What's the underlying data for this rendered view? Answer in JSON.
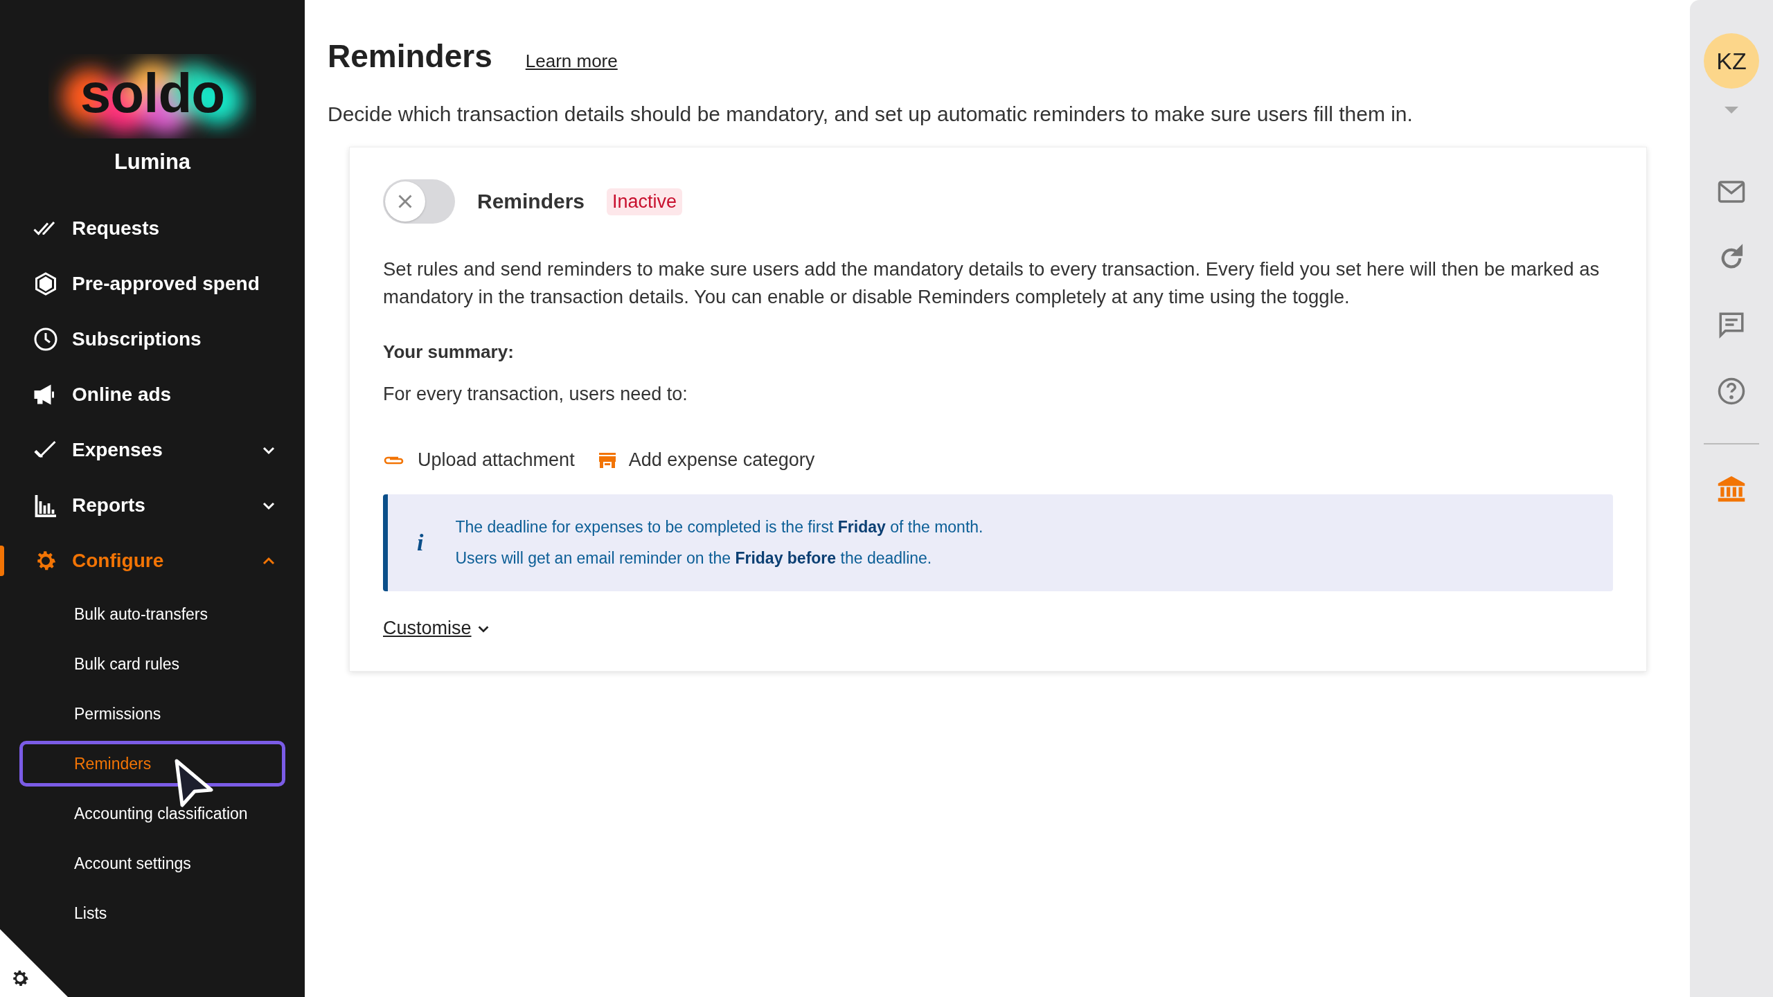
{
  "sidebar": {
    "logo": "soldo",
    "company": "Lumina",
    "items": [
      {
        "label": "Requests",
        "selected": false
      },
      {
        "label": "Pre-approved spend",
        "selected": false
      },
      {
        "label": "Subscriptions",
        "selected": false
      },
      {
        "label": "Online ads",
        "selected": false
      },
      {
        "label": "Expenses",
        "selected": false,
        "expanded": false
      },
      {
        "label": "Reports",
        "selected": false,
        "expanded": false
      },
      {
        "label": "Configure",
        "selected": true,
        "expanded": true,
        "children": [
          {
            "label": "Bulk auto-transfers",
            "selected": false
          },
          {
            "label": "Bulk card rules",
            "selected": false
          },
          {
            "label": "Permissions",
            "selected": false
          },
          {
            "label": "Reminders",
            "selected": true
          },
          {
            "label": "Accounting classification",
            "selected": false
          },
          {
            "label": "Account settings",
            "selected": false
          },
          {
            "label": "Lists",
            "selected": false
          }
        ]
      }
    ]
  },
  "page": {
    "title": "Reminders",
    "learn_more": "Learn more",
    "description": "Decide which transaction details should be mandatory, and set up automatic reminders to make sure users fill them in."
  },
  "card": {
    "toggle": {
      "on": false
    },
    "title": "Reminders",
    "status": "Inactive",
    "body": "Set rules and send reminders to make sure users add the mandatory details to every transaction. Every field you set here will then be marked as mandatory in the transaction details. You can enable or disable Reminders completely at any time using the toggle.",
    "summary_heading": "Your summary:",
    "summary_intro": "For every transaction, users need to:",
    "requirements": [
      "Upload attachment",
      "Add expense category"
    ],
    "info_icon": "i",
    "info": [
      "The deadline for expenses to be completed is the first **Friday** of the month.",
      "Users will get an email reminder on the **Friday before** the deadline."
    ],
    "customise": "Customise"
  },
  "rail": {
    "avatar": "KZ"
  }
}
